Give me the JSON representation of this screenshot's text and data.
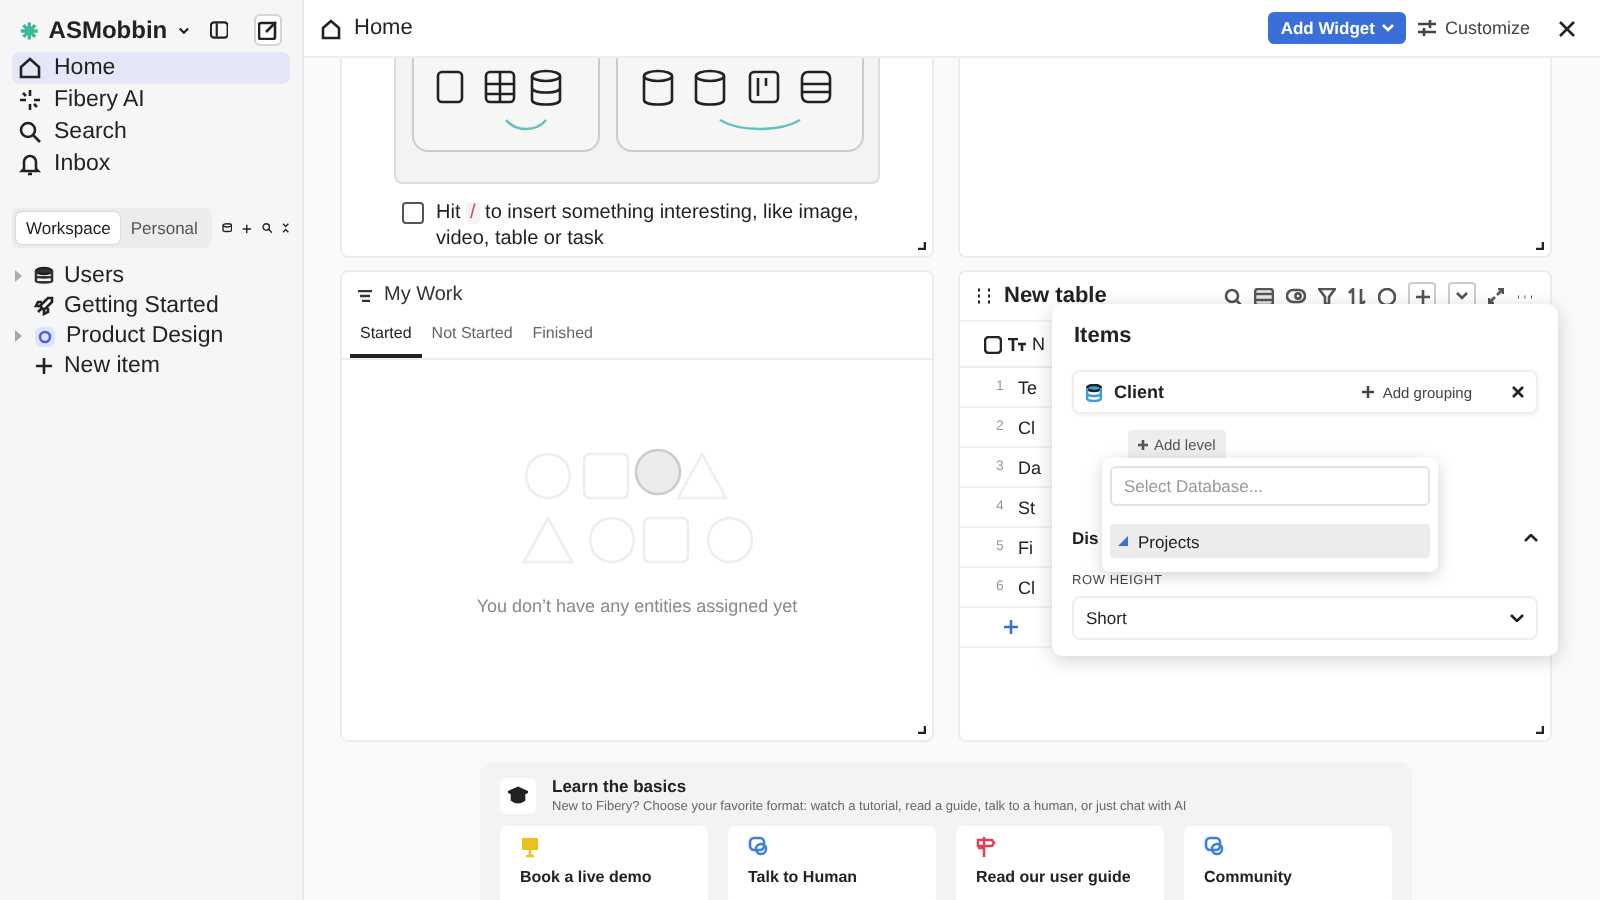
{
  "sidebar": {
    "workspace_name": "ASMobbin",
    "nav": [
      {
        "label": "Home",
        "selected": true
      },
      {
        "label": "Fibery AI",
        "selected": false
      },
      {
        "label": "Search",
        "selected": false
      },
      {
        "label": "Inbox",
        "selected": false
      }
    ],
    "scope_tabs": [
      {
        "label": "Workspace",
        "selected": true
      },
      {
        "label": "Personal",
        "selected": false
      }
    ],
    "tree": [
      {
        "label": "Users",
        "kind": "database",
        "expanded": false
      },
      {
        "label": "Getting Started",
        "kind": "rocket"
      },
      {
        "label": "Product Design",
        "kind": "app",
        "expanded": false
      },
      {
        "label": "New item",
        "kind": "add"
      }
    ]
  },
  "topbar": {
    "title": "Home",
    "add_widget": "Add Widget",
    "customize": "Customize"
  },
  "note_widget": {
    "task": {
      "checked": false,
      "prefix": "Hit",
      "key": "/",
      "suffix": "to insert something interesting, like image, video, table or task"
    }
  },
  "my_work": {
    "title": "My Work",
    "tabs": [
      {
        "label": "Started",
        "selected": true
      },
      {
        "label": "Not Started",
        "selected": false
      },
      {
        "label": "Finished",
        "selected": false
      }
    ],
    "empty_text": "You don’t have any entities assigned yet"
  },
  "table_widget": {
    "title": "New table",
    "column": "N",
    "rows": [
      {
        "number": "1",
        "name": "Te"
      },
      {
        "number": "2",
        "name": "Cl"
      },
      {
        "number": "3",
        "name": "Da"
      },
      {
        "number": "4",
        "name": "St"
      },
      {
        "number": "5",
        "name": "Fi"
      },
      {
        "number": "6",
        "name": "Cl"
      }
    ]
  },
  "items_popup": {
    "title": "Items",
    "level": {
      "name": "Client",
      "add_grouping": "Add grouping"
    },
    "add_level": "Add level",
    "section": "Dis",
    "row_height_label": "ROW HEIGHT",
    "row_height": "Short"
  },
  "database_picker": {
    "placeholder": "Select Database...",
    "options": [
      {
        "label": "Projects",
        "selected": true
      }
    ]
  },
  "learn": {
    "title": "Learn the basics",
    "subtitle": "New to Fibery? Choose your favorite format: watch a tutorial, read a guide, talk to a human, or just chat with AI",
    "cards": [
      {
        "title": "Book a live demo",
        "color": "#e8c21e"
      },
      {
        "title": "Talk to Human",
        "color": "#3b82d6"
      },
      {
        "title": "Read our user guide",
        "color": "#e0415a"
      },
      {
        "title": "Community",
        "color": "#3b82d6"
      }
    ]
  }
}
